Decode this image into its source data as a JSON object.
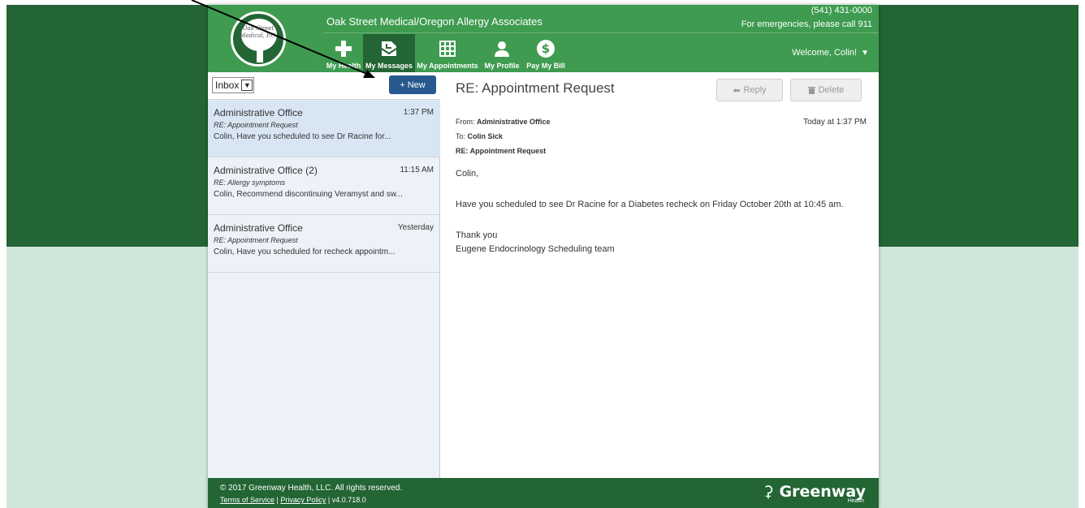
{
  "header": {
    "practice_name": "Oak Street Medical/Oregon Allergy Associates",
    "phone": "(541) 431-0000",
    "emergency": "For emergencies, please call 911",
    "welcome": "Welcome, Colin!",
    "logo_text": "Oak Street Medical, P.C."
  },
  "nav": {
    "items": [
      {
        "label": "My Health",
        "icon": "plus-icon"
      },
      {
        "label": "My Messages",
        "icon": "envelope-icon"
      },
      {
        "label": "My Appointments",
        "icon": "calendar-icon"
      },
      {
        "label": "My Profile",
        "icon": "person-icon"
      },
      {
        "label": "Pay My Bill",
        "icon": "dollar-icon"
      }
    ],
    "active": "My Messages"
  },
  "inbox": {
    "folder": "Inbox",
    "new_label": "+ New",
    "messages": [
      {
        "sender": "Administrative Office",
        "time": "1:37 PM",
        "subject": "RE: Appointment Request",
        "preview": "Colin, Have you scheduled to see Dr Racine for..."
      },
      {
        "sender": "Administrative Office (2)",
        "time": "11:15 AM",
        "subject": "RE: Allergy symptoms",
        "preview": "Colin, Recommend discontinuing Veramyst and sw..."
      },
      {
        "sender": "Administrative Office",
        "time": "Yesterday",
        "subject": "RE: Appointment Request",
        "preview": "Colin, Have you scheduled for recheck appointm..."
      }
    ]
  },
  "reader": {
    "title": "RE: Appointment Request",
    "reply_label": "Reply",
    "delete_label": "Delete",
    "from_label": "From:",
    "from": "Administrative Office",
    "to_label": "To:",
    "to": "Colin Sick",
    "subject": "RE: Appointment Request",
    "date": "Today at 1:37 PM",
    "body": [
      "Colin,",
      "Have you scheduled to see Dr Racine for a Diabetes recheck on Friday October 20th at 10:45 am.",
      "Thank you",
      "Eugene Endocrinology Scheduling team"
    ]
  },
  "footer": {
    "copyright": "© 2017 Greenway Health, LLC. All rights reserved.",
    "terms": "Terms of Service",
    "privacy": "Privacy Policy",
    "version": "v4.0.718.0",
    "brand": "Greenway",
    "brand_sub": "Health"
  },
  "colors": {
    "dark_green": "#236534",
    "header_green": "#3e9b50",
    "light_green": "#d1e6db",
    "new_button": "#27588e"
  }
}
